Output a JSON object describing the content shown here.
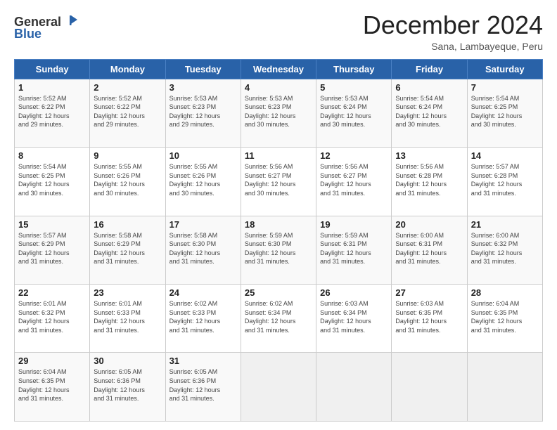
{
  "logo": {
    "line1": "General",
    "line2": "Blue"
  },
  "title": "December 2024",
  "location": "Sana, Lambayeque, Peru",
  "header": {
    "days": [
      "Sunday",
      "Monday",
      "Tuesday",
      "Wednesday",
      "Thursday",
      "Friday",
      "Saturday"
    ]
  },
  "weeks": [
    [
      {
        "day": "1",
        "info": "Sunrise: 5:52 AM\nSunset: 6:22 PM\nDaylight: 12 hours\nand 29 minutes."
      },
      {
        "day": "2",
        "info": "Sunrise: 5:52 AM\nSunset: 6:22 PM\nDaylight: 12 hours\nand 29 minutes."
      },
      {
        "day": "3",
        "info": "Sunrise: 5:53 AM\nSunset: 6:23 PM\nDaylight: 12 hours\nand 29 minutes."
      },
      {
        "day": "4",
        "info": "Sunrise: 5:53 AM\nSunset: 6:23 PM\nDaylight: 12 hours\nand 30 minutes."
      },
      {
        "day": "5",
        "info": "Sunrise: 5:53 AM\nSunset: 6:24 PM\nDaylight: 12 hours\nand 30 minutes."
      },
      {
        "day": "6",
        "info": "Sunrise: 5:54 AM\nSunset: 6:24 PM\nDaylight: 12 hours\nand 30 minutes."
      },
      {
        "day": "7",
        "info": "Sunrise: 5:54 AM\nSunset: 6:25 PM\nDaylight: 12 hours\nand 30 minutes."
      }
    ],
    [
      {
        "day": "8",
        "info": "Sunrise: 5:54 AM\nSunset: 6:25 PM\nDaylight: 12 hours\nand 30 minutes."
      },
      {
        "day": "9",
        "info": "Sunrise: 5:55 AM\nSunset: 6:26 PM\nDaylight: 12 hours\nand 30 minutes."
      },
      {
        "day": "10",
        "info": "Sunrise: 5:55 AM\nSunset: 6:26 PM\nDaylight: 12 hours\nand 30 minutes."
      },
      {
        "day": "11",
        "info": "Sunrise: 5:56 AM\nSunset: 6:27 PM\nDaylight: 12 hours\nand 30 minutes."
      },
      {
        "day": "12",
        "info": "Sunrise: 5:56 AM\nSunset: 6:27 PM\nDaylight: 12 hours\nand 31 minutes."
      },
      {
        "day": "13",
        "info": "Sunrise: 5:56 AM\nSunset: 6:28 PM\nDaylight: 12 hours\nand 31 minutes."
      },
      {
        "day": "14",
        "info": "Sunrise: 5:57 AM\nSunset: 6:28 PM\nDaylight: 12 hours\nand 31 minutes."
      }
    ],
    [
      {
        "day": "15",
        "info": "Sunrise: 5:57 AM\nSunset: 6:29 PM\nDaylight: 12 hours\nand 31 minutes."
      },
      {
        "day": "16",
        "info": "Sunrise: 5:58 AM\nSunset: 6:29 PM\nDaylight: 12 hours\nand 31 minutes."
      },
      {
        "day": "17",
        "info": "Sunrise: 5:58 AM\nSunset: 6:30 PM\nDaylight: 12 hours\nand 31 minutes."
      },
      {
        "day": "18",
        "info": "Sunrise: 5:59 AM\nSunset: 6:30 PM\nDaylight: 12 hours\nand 31 minutes."
      },
      {
        "day": "19",
        "info": "Sunrise: 5:59 AM\nSunset: 6:31 PM\nDaylight: 12 hours\nand 31 minutes."
      },
      {
        "day": "20",
        "info": "Sunrise: 6:00 AM\nSunset: 6:31 PM\nDaylight: 12 hours\nand 31 minutes."
      },
      {
        "day": "21",
        "info": "Sunrise: 6:00 AM\nSunset: 6:32 PM\nDaylight: 12 hours\nand 31 minutes."
      }
    ],
    [
      {
        "day": "22",
        "info": "Sunrise: 6:01 AM\nSunset: 6:32 PM\nDaylight: 12 hours\nand 31 minutes."
      },
      {
        "day": "23",
        "info": "Sunrise: 6:01 AM\nSunset: 6:33 PM\nDaylight: 12 hours\nand 31 minutes."
      },
      {
        "day": "24",
        "info": "Sunrise: 6:02 AM\nSunset: 6:33 PM\nDaylight: 12 hours\nand 31 minutes."
      },
      {
        "day": "25",
        "info": "Sunrise: 6:02 AM\nSunset: 6:34 PM\nDaylight: 12 hours\nand 31 minutes."
      },
      {
        "day": "26",
        "info": "Sunrise: 6:03 AM\nSunset: 6:34 PM\nDaylight: 12 hours\nand 31 minutes."
      },
      {
        "day": "27",
        "info": "Sunrise: 6:03 AM\nSunset: 6:35 PM\nDaylight: 12 hours\nand 31 minutes."
      },
      {
        "day": "28",
        "info": "Sunrise: 6:04 AM\nSunset: 6:35 PM\nDaylight: 12 hours\nand 31 minutes."
      }
    ],
    [
      {
        "day": "29",
        "info": "Sunrise: 6:04 AM\nSunset: 6:35 PM\nDaylight: 12 hours\nand 31 minutes."
      },
      {
        "day": "30",
        "info": "Sunrise: 6:05 AM\nSunset: 6:36 PM\nDaylight: 12 hours\nand 31 minutes."
      },
      {
        "day": "31",
        "info": "Sunrise: 6:05 AM\nSunset: 6:36 PM\nDaylight: 12 hours\nand 31 minutes."
      },
      null,
      null,
      null,
      null
    ]
  ]
}
